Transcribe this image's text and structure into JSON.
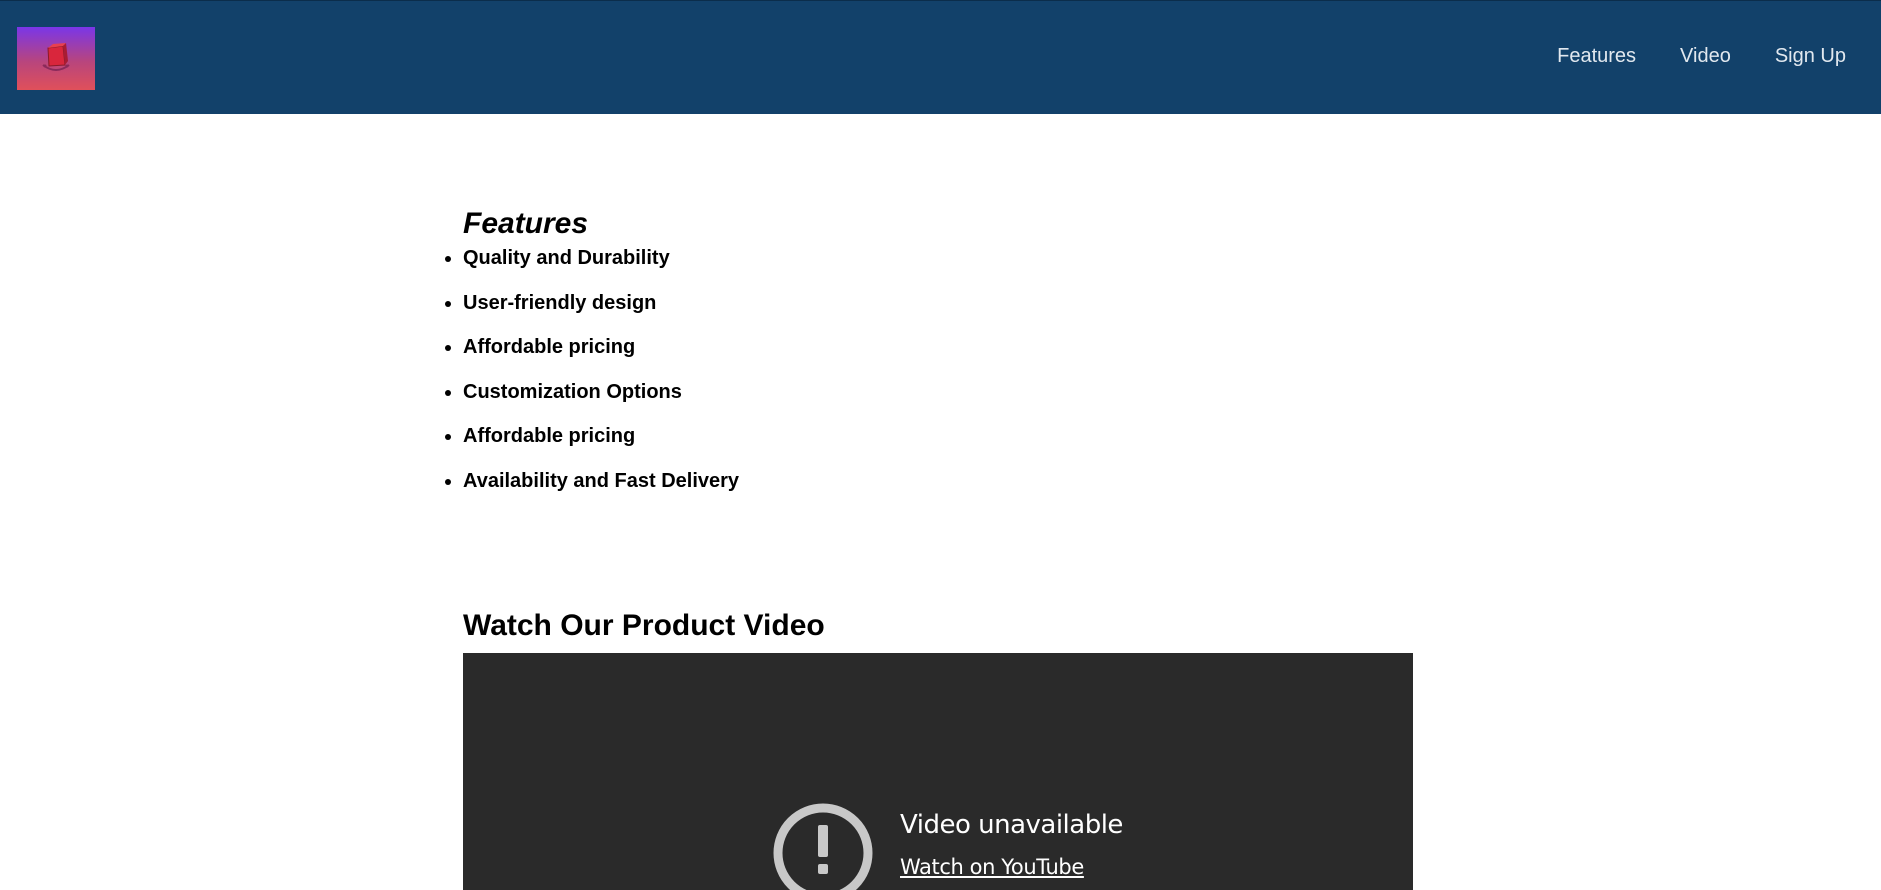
{
  "navbar": {
    "logo_icon": "shopping-bag-logo-icon",
    "links": [
      "Features",
      "Video",
      "Sign Up"
    ],
    "background": "#12416a"
  },
  "features": {
    "title": "Features",
    "items": [
      "Quality and Durability",
      "User-friendly design",
      "Affordable pricing",
      "Customization Options",
      "Affordable pricing",
      "Availability and Fast Delivery"
    ]
  },
  "video": {
    "title": "Watch Our Product Video",
    "status": "Video unavailable",
    "watch_link": "Watch on YouTube",
    "error_icon": "exclamation-circle-icon",
    "background": "#2a2a2a"
  }
}
